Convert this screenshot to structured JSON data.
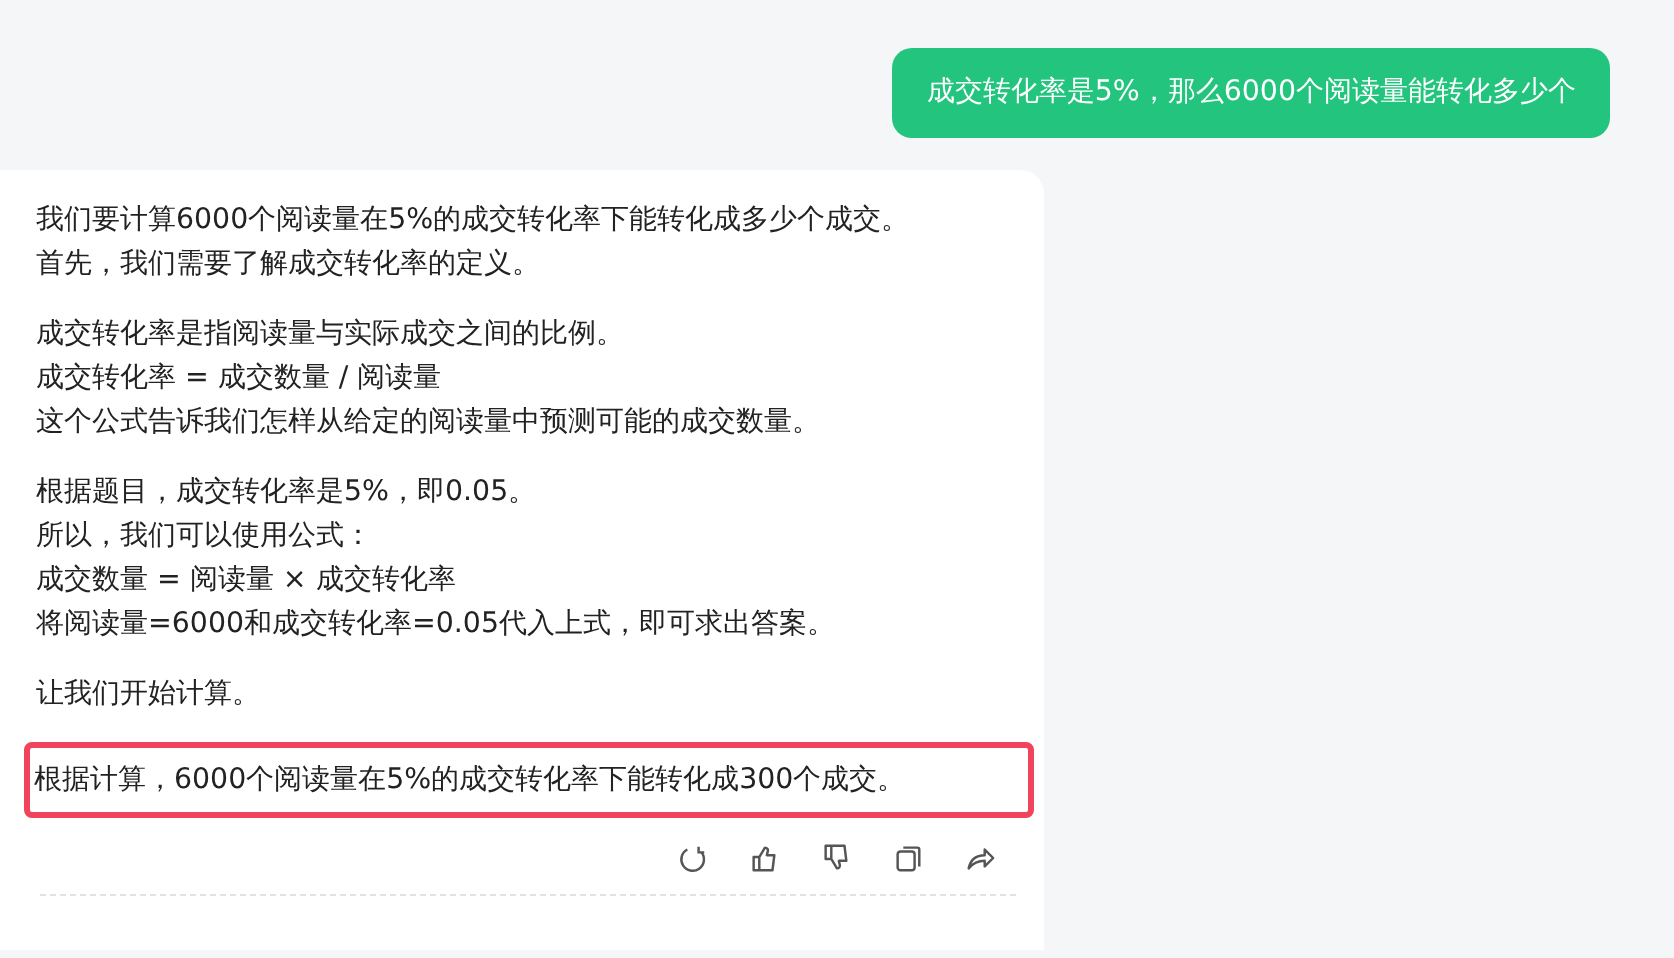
{
  "user_message": {
    "text": "成交转化率是5%，那么6000个阅读量能转化多少个"
  },
  "reply": {
    "paragraphs": [
      {
        "highlighted": false,
        "lines": [
          "我们要计算6000个阅读量在5%的成交转化率下能转化成多少个成交。",
          "首先，我们需要了解成交转化率的定义。"
        ]
      },
      {
        "highlighted": false,
        "lines": [
          "成交转化率是指阅读量与实际成交之间的比例。",
          "成交转化率 = 成交数量 / 阅读量",
          "这个公式告诉我们怎样从给定的阅读量中预测可能的成交数量。"
        ]
      },
      {
        "highlighted": false,
        "lines": [
          "根据题目，成交转化率是5%，即0.05。",
          "所以，我们可以使用公式：",
          "成交数量 = 阅读量 × 成交转化率",
          "将阅读量=6000和成交转化率=0.05代入上式，即可求出答案。"
        ]
      },
      {
        "highlighted": false,
        "lines": [
          "让我们开始计算。"
        ]
      },
      {
        "highlighted": true,
        "lines": [
          "根据计算，6000个阅读量在5%的成交转化率下能转化成300个成交。"
        ]
      }
    ],
    "actions": [
      {
        "kind": "regenerate"
      },
      {
        "kind": "like"
      },
      {
        "kind": "dislike"
      },
      {
        "kind": "copy"
      },
      {
        "kind": "share"
      }
    ]
  }
}
